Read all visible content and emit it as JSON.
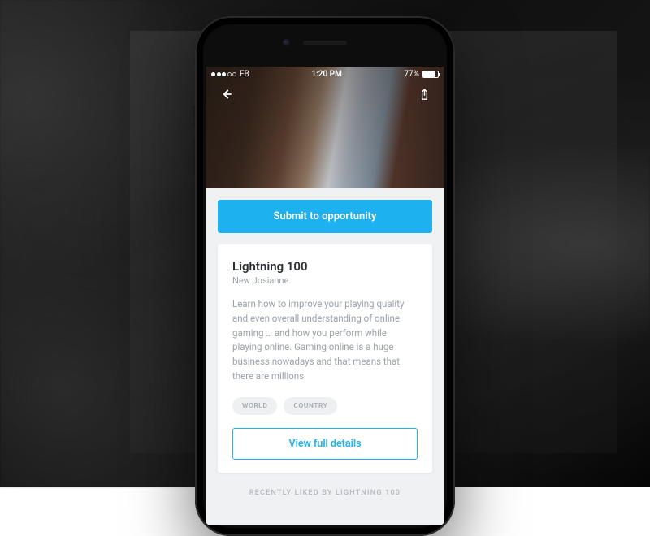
{
  "status": {
    "carrier": "FB",
    "time": "1:20 PM",
    "battery_pct": "77%"
  },
  "hero": {
    "back_icon": "back",
    "share_icon": "share"
  },
  "actions": {
    "submit_label": "Submit to opportunity"
  },
  "card": {
    "title": "Lightning 100",
    "subtitle": "New Josianne",
    "body": "Learn how to improve your playing quality and even overall understanding of online gaming … and how you perform while playing online. Gaming online is a huge business nowadays and that means that there are millions.",
    "tags": [
      "WORLD",
      "COUNTRY"
    ],
    "view_label": "View full details"
  },
  "footer": {
    "text": "RECENTLY LIKED BY LIGHTNING 100"
  },
  "colors": {
    "accent": "#1eb1f0"
  }
}
